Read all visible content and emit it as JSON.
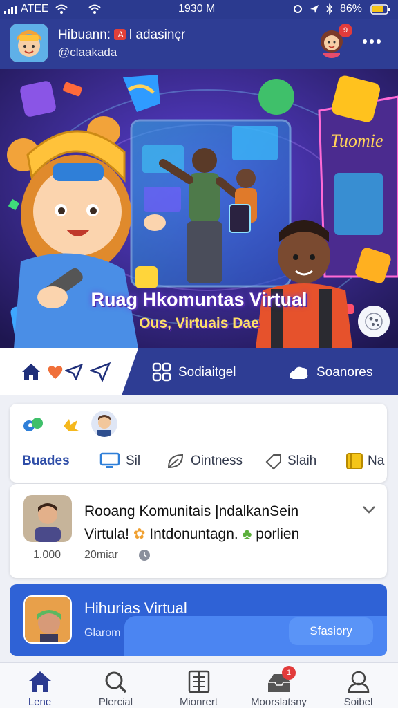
{
  "status_bar": {
    "carrier": "ATEE",
    "time": "1930 M",
    "battery": "86%"
  },
  "header": {
    "title": "Hibuann:",
    "title_suffix": "l adasinçr",
    "badge_mark": "'A",
    "subtitle": "@claakada",
    "notification_count": "9"
  },
  "hero": {
    "title": "Ruag Hkomuntas Virtual",
    "subtitle": "Ous, Virtuais Dae"
  },
  "tabs": [
    {
      "label": "Sodiaitgel"
    },
    {
      "label": "Soanores"
    }
  ],
  "filters": [
    {
      "label": "Buades"
    },
    {
      "label": "Sil"
    },
    {
      "label": "Ointness"
    },
    {
      "label": "Slaih"
    },
    {
      "label": "Na"
    }
  ],
  "post": {
    "line1": "Rooang Komunitais |ndalkanSein",
    "line2_a": "Virtula!",
    "line2_b": "Intdonuntagn.",
    "line2_c": "porlien",
    "count": "1.000",
    "time": "20miar"
  },
  "featured": {
    "title": "Hihurias Virtual",
    "subtitle": "Glarom",
    "button": "Sfasiory"
  },
  "bottom_nav": [
    {
      "label": "Lene"
    },
    {
      "label": "Plercial"
    },
    {
      "label": "Mionrert"
    },
    {
      "label": "Moorslatsny",
      "badge": "1"
    },
    {
      "label": "Soibel"
    }
  ],
  "colors": {
    "primary": "#2e3d94",
    "accent_blue": "#2f62d6",
    "hero_bg": "#3a2a8c"
  }
}
